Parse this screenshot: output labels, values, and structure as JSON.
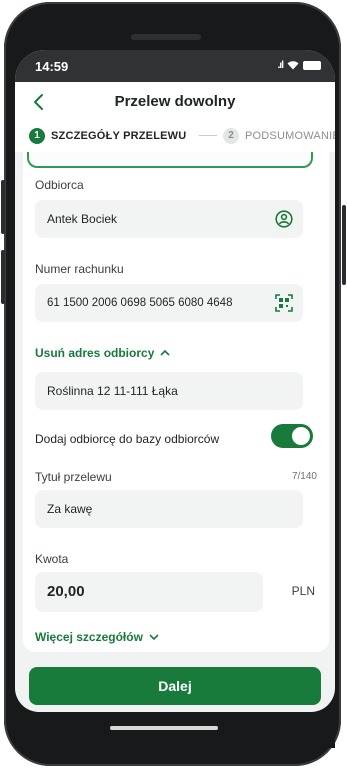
{
  "status": {
    "time": "14:59"
  },
  "header": {
    "title": "Przelew dowolny"
  },
  "steps": [
    {
      "number": "1",
      "label": "SZCZEGÓŁY PRZELEWU"
    },
    {
      "number": "2",
      "label": "PODSUMOWANIE"
    }
  ],
  "form": {
    "recipient": {
      "label": "Odbiorca",
      "value": "Antek Bociek"
    },
    "account": {
      "label": "Numer rachunku",
      "value": "61 1500 2006 0698 5065 6080 4648"
    },
    "remove_address_link": "Usuń adres odbiorcy",
    "address": {
      "value": "Roślinna 12 11-111 Łąka"
    },
    "save_recipient": {
      "label": "Dodaj odbiorcę do bazy odbiorców",
      "enabled": true
    },
    "title": {
      "label": "Tytuł przelewu",
      "counter": "7/140",
      "value": "Za kawę"
    },
    "amount": {
      "label": "Kwota",
      "value": "20,00",
      "currency": "PLN"
    },
    "more_details_link": "Więcej szczegółów"
  },
  "actions": {
    "next_label": "Dalej"
  },
  "colors": {
    "primary": "#187a3b",
    "field_bg": "#f2f3f3",
    "frame": "#17191b"
  }
}
